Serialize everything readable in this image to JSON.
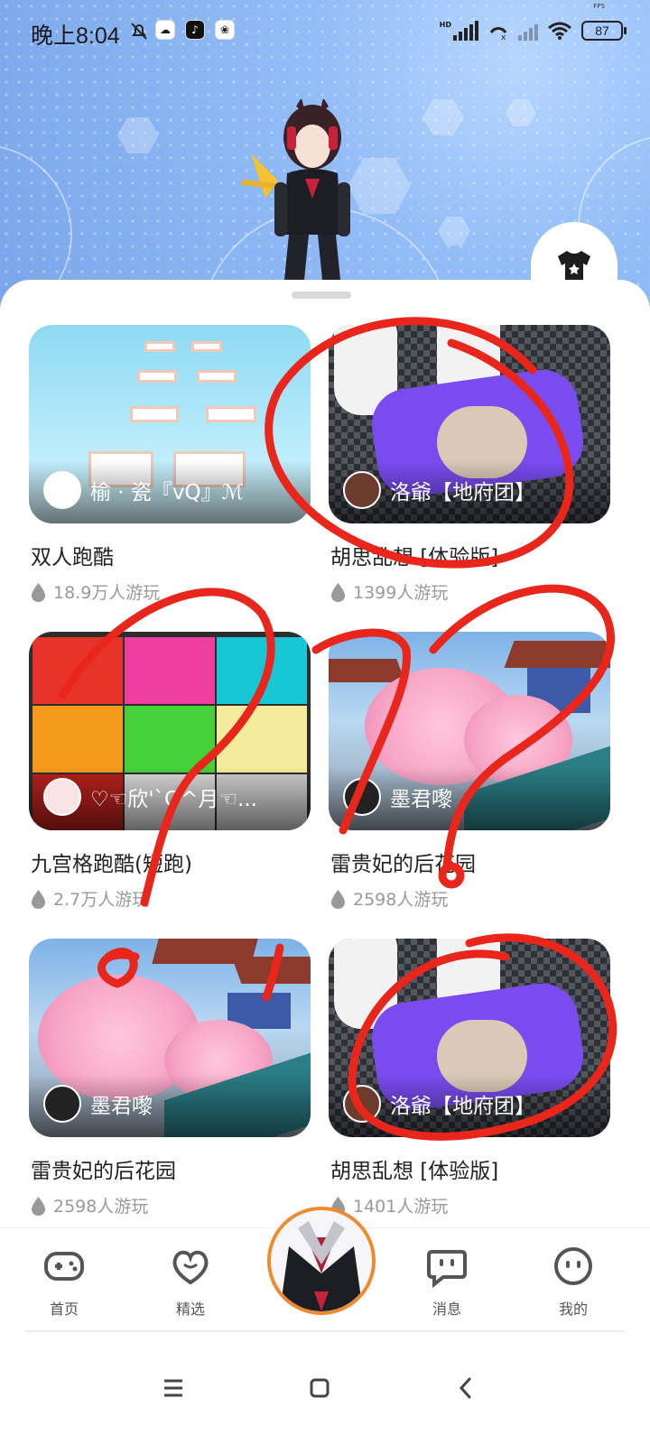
{
  "status_bar": {
    "time": "晚上8:04",
    "battery": "87",
    "net_tag": "HD",
    "fps_label": "FPS"
  },
  "feed": {
    "games": [
      {
        "title": "双人跑酷",
        "author": "榆 · 瓷『vQ』ℳ",
        "plays": "18.9万人游玩"
      },
      {
        "title": "胡思乱想 [体验版]",
        "author": "洛爺【地府团】",
        "plays": "1399人游玩"
      },
      {
        "title": "九宫格跑酷(短跑)",
        "author": "♡☜欣'`O^月☜...",
        "plays": "2.7万人游玩"
      },
      {
        "title": "雷贵妃的后花园",
        "author": "墨君嚟",
        "plays": "2598人游玩"
      },
      {
        "title": "雷贵妃的后花园",
        "author": "墨君嚟",
        "plays": "2598人游玩"
      },
      {
        "title": "胡思乱想 [体验版]",
        "author": "洛爺【地府团】",
        "plays": "1401人游玩"
      }
    ]
  },
  "bottom_nav": {
    "home": "首页",
    "featured": "精选",
    "messages": "消息",
    "mine": "我的"
  },
  "icons": {
    "wardrobe": "tshirt-icon",
    "plays": "flame-drop-icon",
    "home": "gamepad-icon",
    "featured": "heart-bubble-icon",
    "messages": "chat-bubble-icon",
    "mine": "smiley-icon"
  },
  "colors": {
    "accent_orange": "#f08a2c",
    "hero_blue": "#93bdf7",
    "scribble_red": "#e8261c"
  }
}
